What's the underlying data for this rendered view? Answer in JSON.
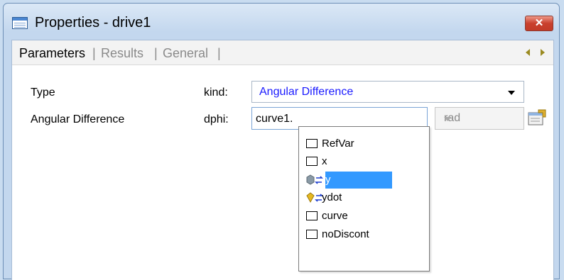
{
  "window": {
    "title": "Properties - drive1",
    "close_label": "✕"
  },
  "tabs": [
    {
      "label": "Parameters",
      "active": true
    },
    {
      "label": "Results",
      "active": false
    },
    {
      "label": "General",
      "active": false
    }
  ],
  "tab_separator": "|",
  "fields": {
    "type": {
      "label": "Type",
      "key": "kind:",
      "value": "Angular Difference"
    },
    "angular_difference": {
      "label": "Angular Difference",
      "key": "dphi:",
      "value": "curve1.",
      "unit": "rad"
    }
  },
  "autocomplete": {
    "items": [
      {
        "label": "RefVar",
        "icon": "empty-box-icon"
      },
      {
        "label": "x",
        "icon": "empty-box-icon"
      },
      {
        "label": "y",
        "icon": "gray-variable-link-icon",
        "selected": true
      },
      {
        "label": "ydot",
        "icon": "yellow-variable-link-icon"
      },
      {
        "label": "curve",
        "icon": "empty-box-icon"
      },
      {
        "label": "noDiscont",
        "icon": "empty-box-icon"
      }
    ]
  },
  "colors": {
    "value_text": "#1a1aff",
    "selection": "#3399ff",
    "close_button": "#c9402d"
  }
}
